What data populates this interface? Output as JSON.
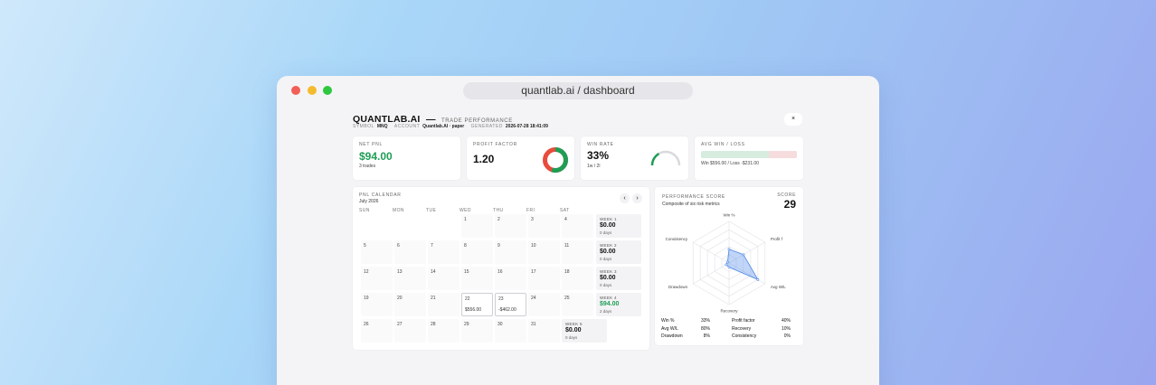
{
  "browser": {
    "url": "quantlab.ai / dashboard"
  },
  "header": {
    "brand": "QUANTLAB.AI",
    "dash": "—",
    "subtitle": "TRADE PERFORMANCE",
    "symbol_label": "SYMBOL",
    "symbol": "MNQ",
    "account_label": "ACCOUNT",
    "account": "Quantlab.AI · paper",
    "generated_label": "GENERATED",
    "generated": "2026-07-28 18:41:09",
    "close_icon_glyph": "×"
  },
  "kpis": {
    "net_pnl": {
      "label": "NET PNL",
      "value": "$94.00",
      "note": "3 trades"
    },
    "profit_factor": {
      "label": "PROFIT FACTOR",
      "value": "1.20",
      "ring_fraction": 0.55
    },
    "win_rate": {
      "label": "WIN RATE",
      "value": "33%",
      "note": "1w / 2l",
      "gauge_fraction": 0.33
    },
    "avg_win_loss": {
      "label": "AVG WIN / LOSS",
      "text": "Win $556.00 / Loss -$231.00"
    }
  },
  "calendar": {
    "label": "PNL CALENDAR",
    "month": "July 2026",
    "prev_glyph": "‹",
    "next_glyph": "›",
    "weekdays": [
      "SUN",
      "MON",
      "TUE",
      "WED",
      "THU",
      "FRI",
      "SAT"
    ],
    "weeks": [
      {
        "days": [
          "",
          "",
          "",
          "1",
          "2",
          "3",
          "4"
        ],
        "summary": {
          "label": "WEEK 1",
          "value": "$0.00",
          "days": "0 days"
        }
      },
      {
        "days": [
          "5",
          "6",
          "7",
          "8",
          "9",
          "10",
          "11"
        ],
        "summary": {
          "label": "WEEK 2",
          "value": "$0.00",
          "days": "0 days"
        }
      },
      {
        "days": [
          "12",
          "13",
          "14",
          "15",
          "16",
          "17",
          "18"
        ],
        "summary": {
          "label": "WEEK 3",
          "value": "$0.00",
          "days": "0 days"
        }
      },
      {
        "days": [
          "19",
          "20",
          "21",
          "22",
          "23",
          "24",
          "25"
        ],
        "summary": {
          "label": "WEEK 4",
          "value": "$94.00",
          "days": "2 days"
        }
      },
      {
        "days": [
          "26",
          "27",
          "28",
          "29",
          "30",
          "31",
          ""
        ],
        "summary": {
          "label": "WEEK 5",
          "value": "$0.00",
          "days": "0 days"
        }
      }
    ],
    "trade_days": {
      "22": "$556.00",
      "23": "-$462.00"
    }
  },
  "performance": {
    "label": "PERFORMANCE SCORE",
    "subtitle": "Composite of six risk metrics",
    "score_label": "SCORE",
    "score": "29",
    "axes": [
      "Win %",
      "Profit f",
      "Avg W/L",
      "Recovery",
      "Drawdown",
      "Consistency"
    ],
    "axis_values": [
      33,
      40,
      80,
      10,
      8,
      0
    ],
    "metrics": [
      {
        "left_label": "Win %",
        "left_value": "33%",
        "right_label": "Profit factor",
        "right_value": "40%"
      },
      {
        "left_label": "Avg W/L",
        "left_value": "80%",
        "right_label": "Recovery",
        "right_value": "10%"
      },
      {
        "left_label": "Drawdown",
        "left_value": "8%",
        "right_label": "Consistency",
        "right_value": "0%"
      }
    ],
    "accent": "#4a86e8"
  },
  "colors": {
    "positive": "#1f9d55",
    "negative": "#e74c3c",
    "neutral_ring": "#d9d9de"
  }
}
